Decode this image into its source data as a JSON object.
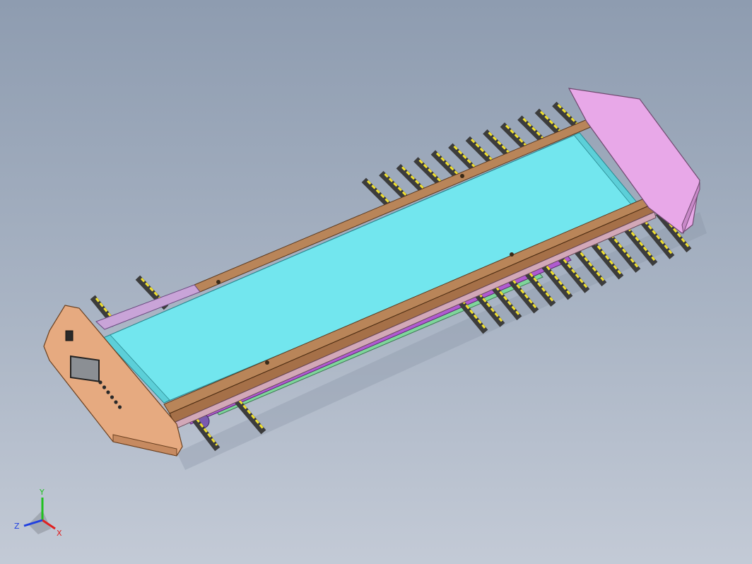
{
  "viewport": {
    "background_top": "#8e9cb0",
    "background_bottom": "#c3cad6"
  },
  "model": {
    "belt_color": "#72e6ee",
    "side_rail_color": "#b98559",
    "end_cap_left_color": "#e6aa80",
    "end_cap_right_color": "#e8a8e8",
    "roller_color": "#f0e030",
    "roller_body_color": "#3c3c3c",
    "frame_green": "#7ed69a",
    "frame_purple": "#b05ad0",
    "frame_blue": "#5c62cc",
    "screen_color": "#8b8f94"
  },
  "triad": {
    "x_label": "X",
    "y_label": "Y",
    "z_label": "Z",
    "x_color": "#e02020",
    "y_color": "#20c020",
    "z_color": "#2040e0"
  }
}
